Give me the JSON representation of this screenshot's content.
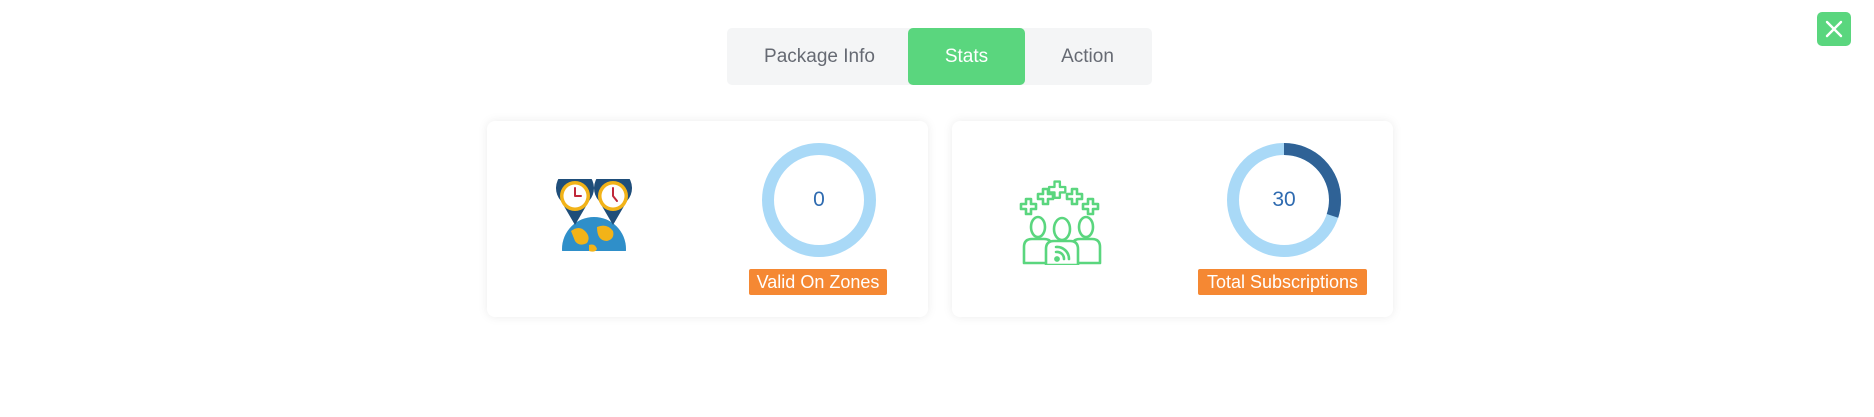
{
  "close_button": {
    "icon": "close-icon"
  },
  "tabs": [
    {
      "label": "Package Info",
      "active": false
    },
    {
      "label": "Stats",
      "active": true
    },
    {
      "label": "Action",
      "active": false
    }
  ],
  "stats": [
    {
      "icon": "world-time-zones-icon",
      "value": "0",
      "label": "Valid On Zones",
      "progress": 0
    },
    {
      "icon": "subscribers-group-icon",
      "value": "30",
      "label": "Total Subscriptions",
      "progress": 0.3
    }
  ],
  "colors": {
    "accent_green": "#5ad67e",
    "badge_orange": "#f58833",
    "ring_track": "#a9d9f7",
    "ring_fill": "#2f6296",
    "value_text": "#2f6bb0"
  }
}
